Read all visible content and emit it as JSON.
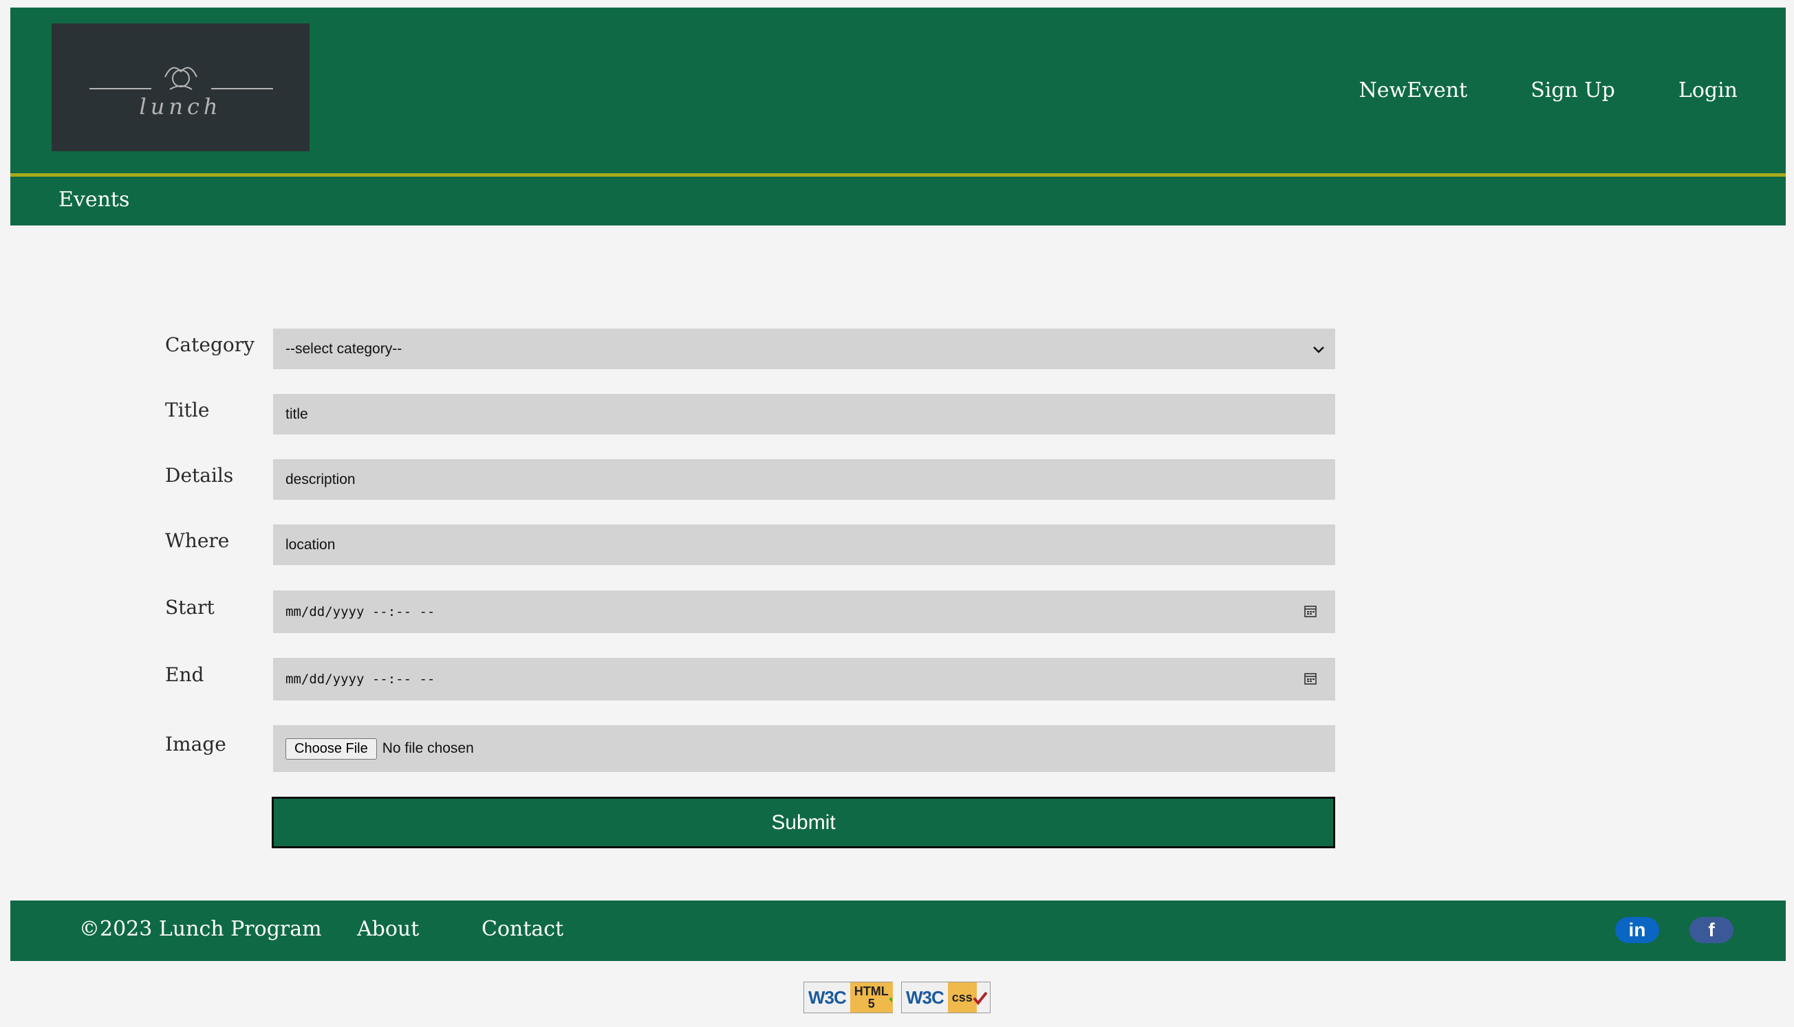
{
  "header": {
    "logo_text": "lunch",
    "nav": [
      "NewEvent",
      "Sign Up",
      "Login"
    ]
  },
  "subnav": {
    "label": "Events"
  },
  "form": {
    "labels": {
      "category": "Category",
      "title": "Title",
      "details": "Details",
      "where": "Where",
      "start": "Start",
      "end": "End",
      "image": "Image"
    },
    "category_selected": "--select category--",
    "title_placeholder": "title",
    "details_placeholder": "description",
    "where_placeholder": "location",
    "start_value": "mm/dd/yyyy --:-- --",
    "end_value": "mm/dd/yyyy --:-- --",
    "file_button": "Choose File",
    "file_status": "No file chosen",
    "submit_label": "Submit"
  },
  "footer": {
    "copyright": "©2023 Lunch Program",
    "about": "About",
    "contact": "Contact",
    "linkedin_label": "in",
    "facebook_label": "f"
  },
  "badges": {
    "w3c": "W3C",
    "html_label": "HTML",
    "html_version": "5",
    "css_label": "css"
  },
  "colors": {
    "brand_green": "#0f6945",
    "gold_line": "#a9a91e",
    "field_bg": "#d3d3d3",
    "linkedin": "#0a66c2",
    "facebook": "#3b5998"
  },
  "icons": [
    "chevron-down-icon",
    "calendar-icon",
    "linkedin-icon",
    "facebook-icon",
    "check-icon"
  ]
}
